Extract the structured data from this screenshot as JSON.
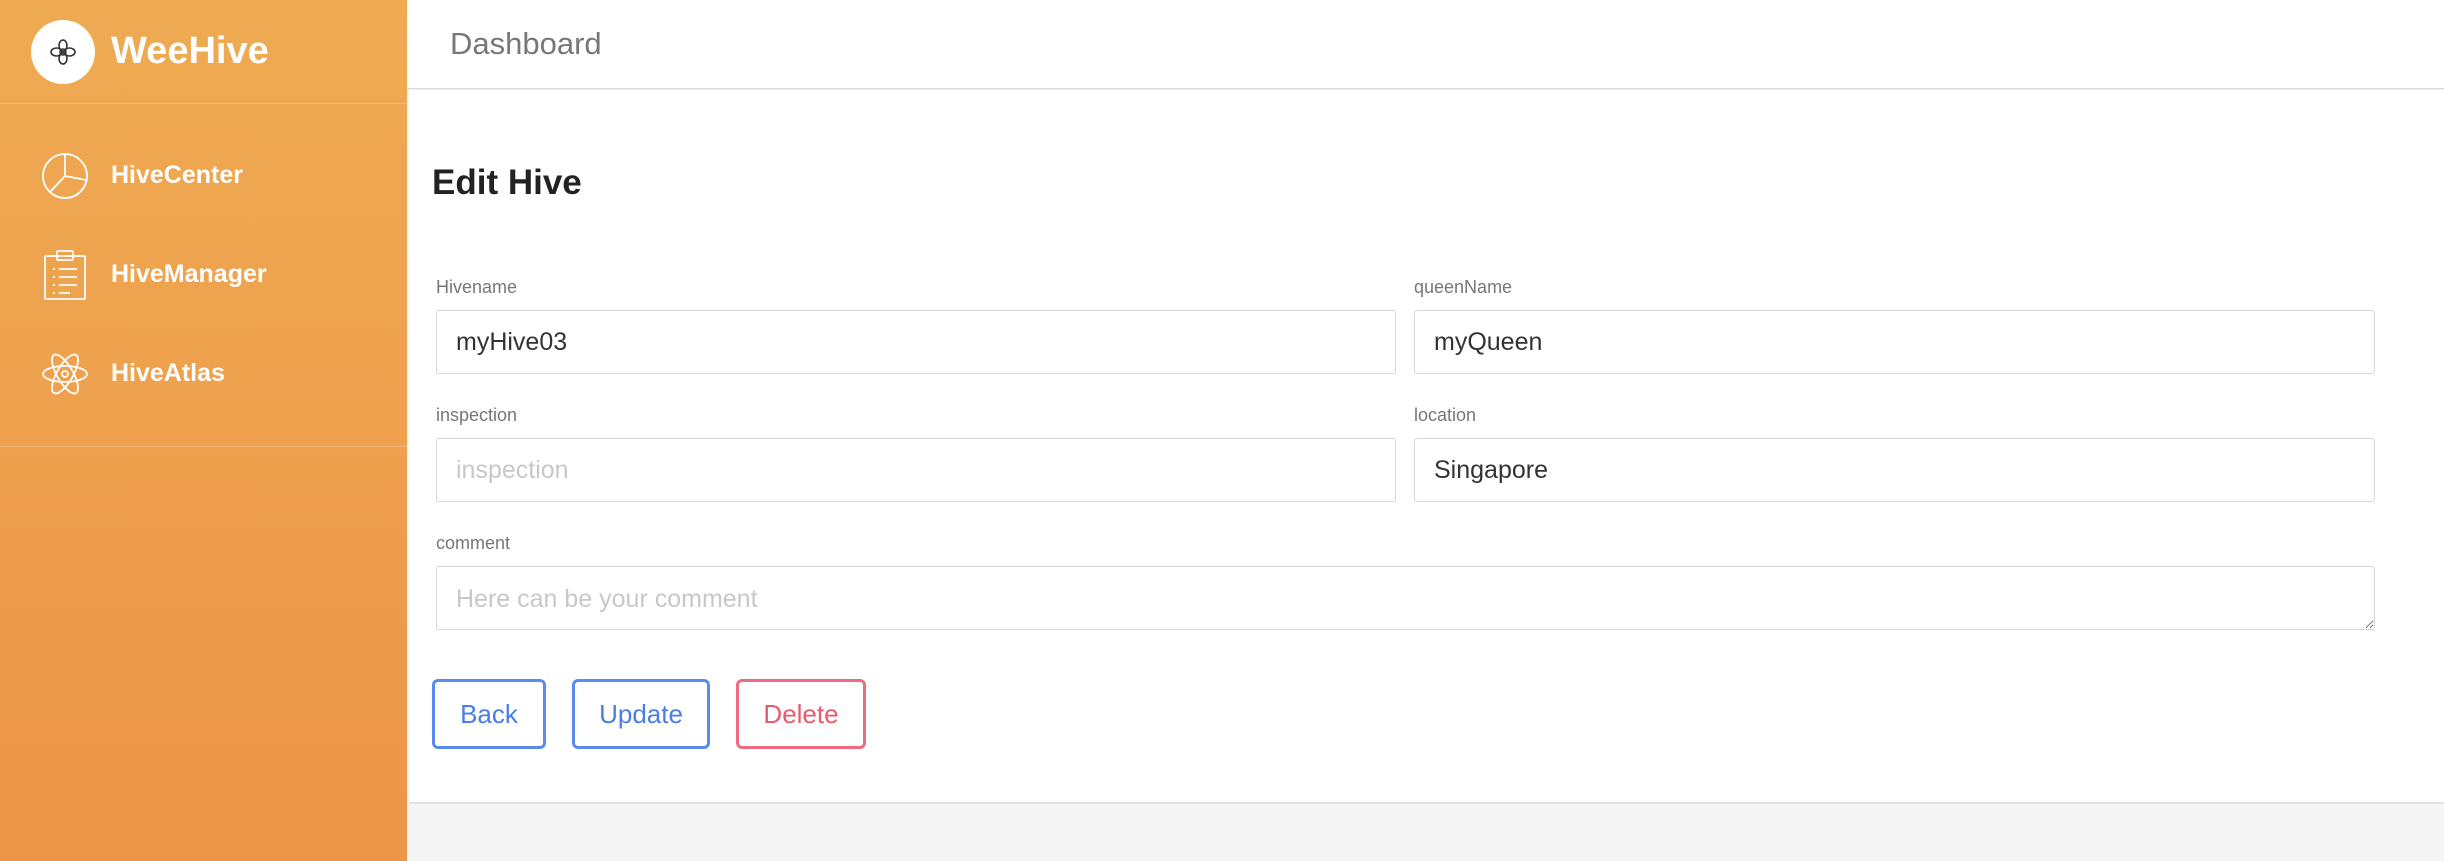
{
  "app": {
    "name": "WeeHive",
    "logo_icon": "flower-icon"
  },
  "sidebar": {
    "items": [
      {
        "label": "HiveCenter",
        "icon": "pie-chart-icon"
      },
      {
        "label": "HiveManager",
        "icon": "clipboard-icon"
      },
      {
        "label": "HiveAtlas",
        "icon": "atom-icon"
      }
    ]
  },
  "header": {
    "title": "Dashboard"
  },
  "form": {
    "title": "Edit Hive",
    "hivename": {
      "label": "Hivename",
      "value": "myHive03",
      "placeholder": ""
    },
    "queenname": {
      "label": "queenName",
      "value": "myQueen",
      "placeholder": ""
    },
    "inspection": {
      "label": "inspection",
      "value": "",
      "placeholder": "inspection"
    },
    "location": {
      "label": "location",
      "value": "Singapore",
      "placeholder": ""
    },
    "comment": {
      "label": "comment",
      "value": "",
      "placeholder": "Here can be your comment"
    }
  },
  "buttons": {
    "back": "Back",
    "update": "Update",
    "delete": "Delete"
  },
  "colors": {
    "sidebar_top": "#eeab52",
    "sidebar_bottom": "#ed9548",
    "primary": "#4a7de8",
    "danger": "#e85a6e"
  }
}
